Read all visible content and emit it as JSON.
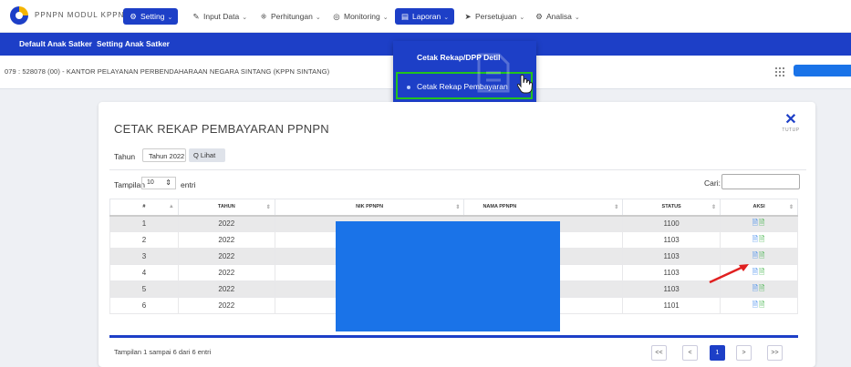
{
  "app": {
    "brand": "PPNPN MODUL KPPN"
  },
  "nav": [
    {
      "label": "Setting",
      "icon": "gear-icon",
      "active": true
    },
    {
      "label": "Input Data",
      "icon": "edit-icon",
      "active": false
    },
    {
      "label": "Perhitungan",
      "icon": "calc-icon",
      "active": false
    },
    {
      "label": "Monitoring",
      "icon": "monitor-icon",
      "active": false
    },
    {
      "label": "Laporan",
      "icon": "report-icon",
      "active": true
    },
    {
      "label": "Persetujuan",
      "icon": "send-icon",
      "active": false
    },
    {
      "label": "Analisa",
      "icon": "gear-icon",
      "active": false
    }
  ],
  "subnav": {
    "item1": "Default Anak Satker",
    "item2": "Setting Anak Satker"
  },
  "office": "079 : 528078 (00) - KANTOR PELAYANAN PERBENDAHARAAN NEGARA SINTANG (KPPN SINTANG)",
  "dropdown": {
    "item1": "Cetak Rekap/DPP Detil",
    "item2": "Cetak Rekap Pembayaran"
  },
  "card": {
    "title": "CETAK REKAP PEMBAYARAN PPNPN",
    "close_label": "TUTUP",
    "tahun_label": "Tahun",
    "tahun_value": "Tahun 2022",
    "lihat_label": "Q Lihat",
    "tampilan_label": "Tampilan",
    "page_len": "10",
    "entri_label": "entri",
    "cari_label": "Cari:"
  },
  "table": {
    "headers": [
      "#",
      "TAHUN",
      "NIK PPNPN",
      "NAMA PPNPN",
      "STATUS",
      "AKSI"
    ],
    "rows": [
      {
        "no": "1",
        "tahun": "2022",
        "status": "1100"
      },
      {
        "no": "2",
        "tahun": "2022",
        "status": "1103"
      },
      {
        "no": "3",
        "tahun": "2022",
        "status": "1103"
      },
      {
        "no": "4",
        "tahun": "2022",
        "status": "1103"
      },
      {
        "no": "5",
        "tahun": "2022",
        "status": "1103"
      },
      {
        "no": "6",
        "tahun": "2022",
        "status": "1101"
      }
    ]
  },
  "footer": {
    "info": "Tampilan 1 sampai 6 dari 6 entri",
    "pagination": [
      "<<",
      "<",
      "1",
      ">",
      ">>"
    ]
  },
  "colors": {
    "primary": "#1d3fc7",
    "redacted": "#1a73e8",
    "highlight": "#22c31e",
    "arrow": "#e02020"
  }
}
